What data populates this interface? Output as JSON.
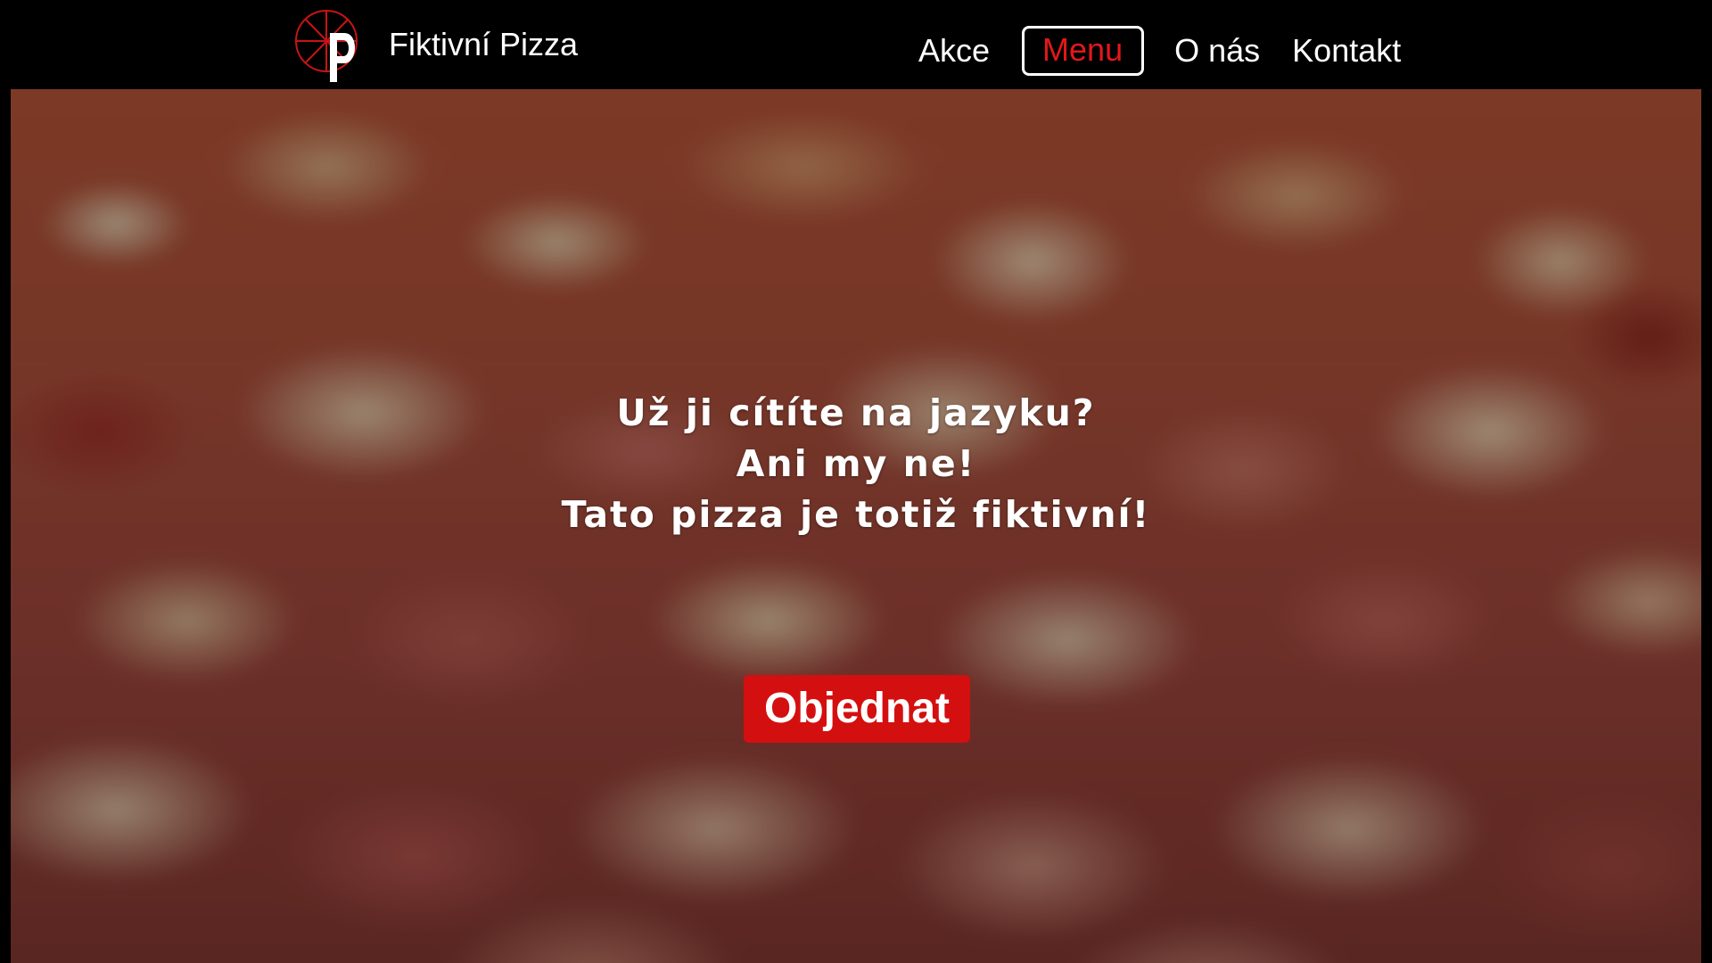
{
  "header": {
    "logo_icon": "pizza-slice-p-logo",
    "brand_name": "Fiktivní Pizza",
    "nav": {
      "akce": "Akce",
      "menu": "Menu",
      "o_nas": "O nás",
      "kontakt": "Kontakt"
    },
    "active_item": "Menu"
  },
  "hero": {
    "background_image": "blurred-pizza-photo",
    "lines": [
      "Už ji cítíte na jazyku?",
      "Ani my ne!",
      "Tato pizza je totiž fiktivní!"
    ],
    "cta_label": "Objednat"
  },
  "colors": {
    "header_bg": "#000000",
    "accent_red": "#d40f0f",
    "active_nav_text": "#e31818",
    "text": "#ffffff"
  }
}
